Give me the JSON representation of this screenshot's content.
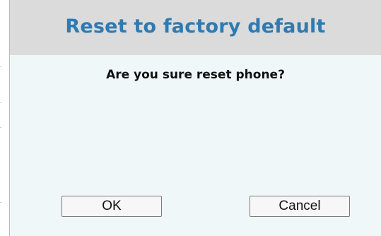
{
  "dialog": {
    "title": "Reset to factory default",
    "message": "Are you sure reset phone?",
    "ok_label": "OK",
    "cancel_label": "Cancel"
  },
  "colors": {
    "title_text": "#2f7ab1",
    "header_background": "#dbdbdb",
    "body_background": "#f0f7f9",
    "button_background": "#f7f7f7",
    "button_border": "#7a7a7a"
  }
}
